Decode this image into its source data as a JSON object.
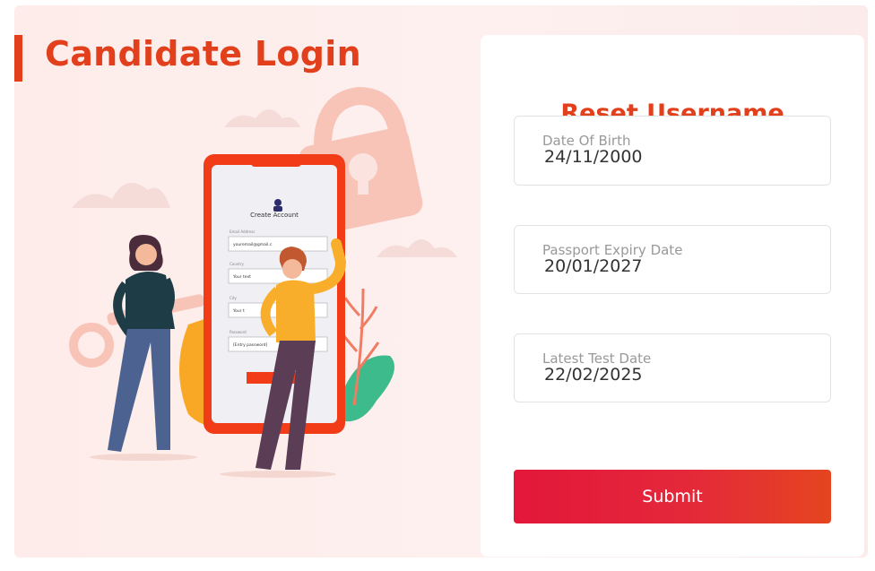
{
  "page": {
    "title": "Candidate Login"
  },
  "illustration": {
    "phone_heading": "Create Account",
    "form_labels": [
      "Email Address",
      "Country",
      "City",
      "Password"
    ],
    "form_values": [
      "youremail@gmail.c",
      "Your text",
      "Your t",
      "[Entry password]"
    ]
  },
  "form": {
    "title": "Reset Username",
    "fields": [
      {
        "label": "Date Of Birth",
        "value": "24/11/2000"
      },
      {
        "label": "Passport Expiry Date",
        "value": "20/01/2027"
      },
      {
        "label": "Latest Test Date",
        "value": "22/02/2025"
      }
    ],
    "submit_label": "Submit"
  },
  "colors": {
    "brand": "#e2401c",
    "button_start": "#e3173a",
    "button_end": "#e54520",
    "background": "#fdecea"
  }
}
